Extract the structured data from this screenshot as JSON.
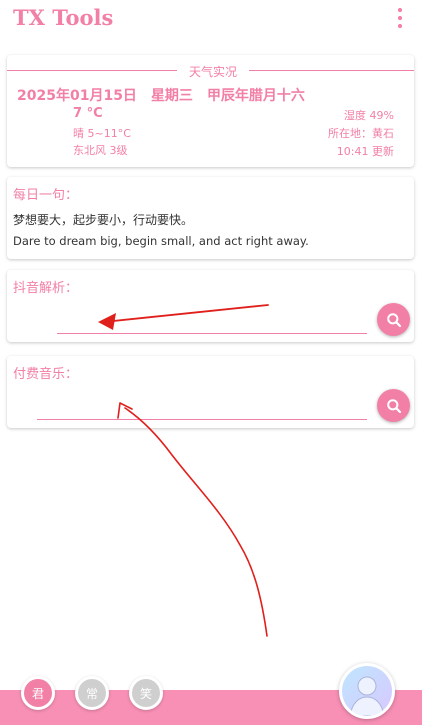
{
  "app": {
    "title": "TX Tools",
    "overflow_icon": "more-vertical-icon"
  },
  "weather": {
    "title": "天气实况",
    "date": "2025年01月15日",
    "weekday": "星期三",
    "lunar": "甲辰年腊月十六",
    "temperature": "7 °C",
    "range": "晴 5~11°C",
    "wind": "东北风 3级",
    "humidity": "湿度 49%",
    "location": "所在地：黄石",
    "update": "10:41 更新"
  },
  "quote": {
    "label": "每日一句：",
    "cn": "梦想要大，起步要小，行动要快。",
    "en": "Dare to dream big, begin small, and act right away."
  },
  "douyin": {
    "label": "抖音解析：",
    "value": "",
    "search_icon": "search-icon"
  },
  "music": {
    "label": "付费音乐：",
    "value": "",
    "search_icon": "search-icon"
  },
  "bottom_nav": {
    "items": [
      {
        "label": "君",
        "active": true
      },
      {
        "label": "常",
        "active": false
      },
      {
        "label": "笑",
        "active": false
      }
    ],
    "avatar_icon": "user-avatar-icon"
  },
  "colors": {
    "accent": "#f27fa5",
    "bottom_bar": "#f890b5",
    "inactive_chip": "#cfcfcf",
    "annotation": "#e0201b"
  }
}
